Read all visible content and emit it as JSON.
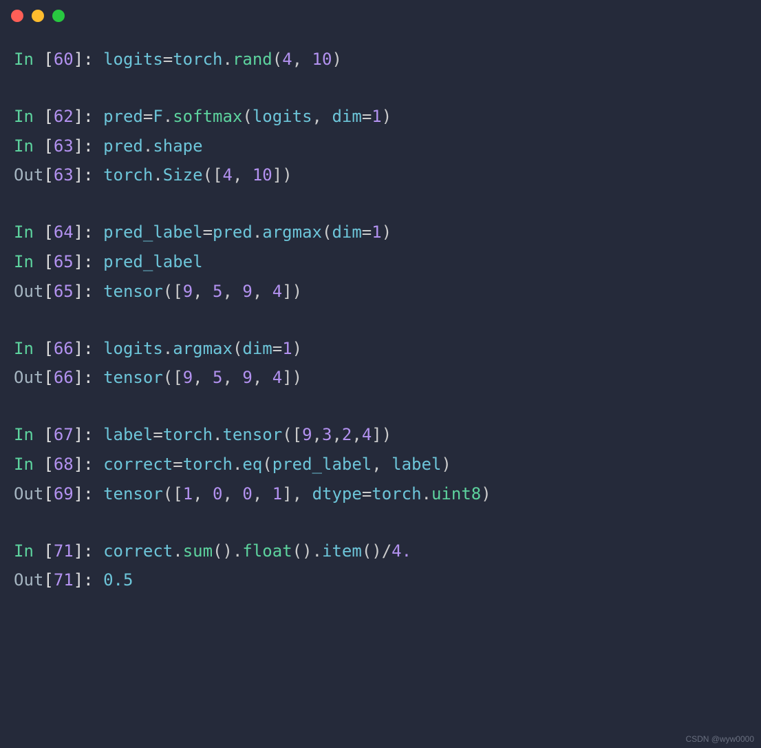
{
  "titlebar": {
    "dots": [
      "red",
      "yellow",
      "green"
    ]
  },
  "cells": {
    "c1": {
      "in_label": "In ",
      "num": "60",
      "tokens": [
        "logits",
        "=",
        "torch",
        ".",
        "rand",
        "(",
        "4",
        ", ",
        "10",
        ")"
      ]
    },
    "c2": {
      "in_label": "In ",
      "num": "62",
      "tokens": [
        "pred",
        "=",
        "F",
        ".",
        "softmax",
        "(",
        "logits",
        ", ",
        "dim",
        "=",
        "1",
        ")"
      ]
    },
    "c3": {
      "in_label": "In ",
      "num": "63",
      "tokens": [
        "pred",
        ".",
        "shape"
      ]
    },
    "c3out": {
      "out_label": "Out",
      "num": "63",
      "tokens": [
        "torch",
        ".",
        "Size",
        "(",
        "[",
        "4",
        ", ",
        "10",
        "]",
        ")"
      ]
    },
    "c4": {
      "in_label": "In ",
      "num": "64",
      "tokens": [
        "pred_label",
        "=",
        "pred",
        ".",
        "argmax",
        "(",
        "dim",
        "=",
        "1",
        ")"
      ]
    },
    "c5": {
      "in_label": "In ",
      "num": "65",
      "tokens": [
        "pred_label"
      ]
    },
    "c5out": {
      "out_label": "Out",
      "num": "65",
      "tokens": [
        "tensor",
        "(",
        "[",
        "9",
        ", ",
        "5",
        ", ",
        "9",
        ", ",
        "4",
        "]",
        ")"
      ]
    },
    "c6": {
      "in_label": "In ",
      "num": "66",
      "tokens": [
        "logits",
        ".",
        "argmax",
        "(",
        "dim",
        "=",
        "1",
        ")"
      ]
    },
    "c6out": {
      "out_label": "Out",
      "num": "66",
      "tokens": [
        "tensor",
        "(",
        "[",
        "9",
        ", ",
        "5",
        ", ",
        "9",
        ", ",
        "4",
        "]",
        ")"
      ]
    },
    "c7": {
      "in_label": "In ",
      "num": "67",
      "tokens": [
        "label",
        "=",
        "torch",
        ".",
        "tensor",
        "(",
        "[",
        "9",
        ",",
        "3",
        ",",
        "2",
        ",",
        "4",
        "]",
        ")"
      ]
    },
    "c8": {
      "in_label": "In ",
      "num": "68",
      "tokens": [
        "correct",
        "=",
        "torch",
        ".",
        "eq",
        "(",
        "pred_label",
        ", ",
        "label",
        ")"
      ]
    },
    "c8out": {
      "out_label": "Out",
      "num": "69",
      "tokens": [
        "tensor",
        "(",
        "[",
        "1",
        ", ",
        "0",
        ", ",
        "0",
        ", ",
        "1",
        "]",
        ", ",
        "dtype",
        "=",
        "torch",
        ".",
        "uint8",
        ")"
      ]
    },
    "c9": {
      "in_label": "In ",
      "num": "71",
      "tokens": [
        "correct",
        ".",
        "sum",
        "(",
        ")",
        ".",
        "float",
        "(",
        ")",
        ".",
        "item",
        "(",
        ")",
        "/",
        "4."
      ]
    },
    "c9out": {
      "out_label": "Out",
      "num": "71",
      "tokens": [
        "0.5"
      ]
    }
  },
  "watermark": "CSDN @wyw0000"
}
